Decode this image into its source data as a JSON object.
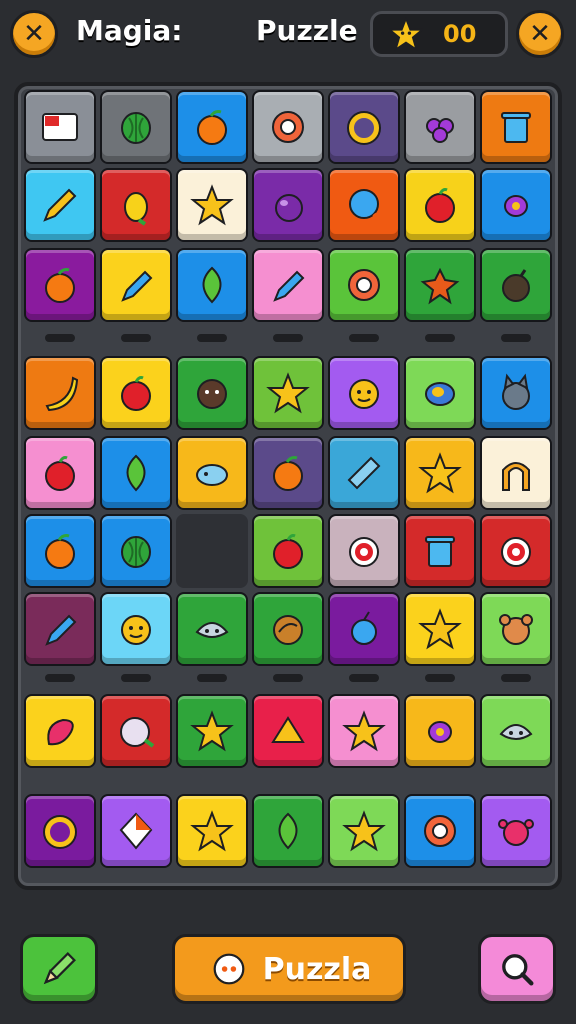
{
  "header": {
    "title_left": "Magia:",
    "title_right": "Puzzle",
    "score": "00",
    "close_glyph": "✕"
  },
  "board": {
    "rows": [
      [
        "#8a8f97",
        "#6f7378",
        "#1d8fe8",
        "#a9aeb3",
        "#5b4a8a",
        "#9a9da1",
        "#ee7a12"
      ],
      [
        "#3fc7f2",
        "#d42a2a",
        "#fbf1d9",
        "#7a2ba8",
        "#f05a12",
        "#f7d21a",
        "#1d8fe8"
      ],
      [
        "#8a1b9e",
        "#fbd21c",
        "#1d8fe8",
        "#f58fd0",
        "#5ac43a",
        "#2fa53a",
        "#2fa53a"
      ],
      [
        "#ee7a12",
        "#fbd21c",
        "#2fa53a",
        "#6fc23a",
        "#a35bf0",
        "#7ed957",
        "#1d8fe8"
      ],
      [
        "#f58fd0",
        "#1d8fe8",
        "#f7b81a",
        "#5b4a8a",
        "#3aa7d8",
        "#f7b81a",
        "#fbf1d9"
      ],
      [
        "#1d8fe8",
        "#1d8fe8",
        null,
        "#6fc23a",
        "#c9b2bd",
        "#d42a2a",
        "#d42a2a"
      ],
      [
        "#7a2b5a",
        "#6cd6f7",
        "#2fa53a",
        "#2fa53a",
        "#7a1b9e",
        "#fbd21c",
        "#7ed957"
      ],
      [
        "#fbd21c",
        "#d42a2a",
        "#2fa53a",
        "#e8204a",
        "#f58fd0",
        "#f7b81a",
        "#7ed957"
      ],
      [
        "#7a1b9e",
        "#a35bf0",
        "#fbd21c",
        "#2fa53a",
        "#7ed957",
        "#1d8fe8",
        "#a35bf0"
      ]
    ],
    "icons": [
      [
        "card",
        "melon",
        "orange",
        "donut",
        "ring",
        "grapes",
        "trash"
      ],
      [
        "pencil",
        "lemon",
        "star",
        "plum",
        "balloon",
        "apple",
        "candy"
      ],
      [
        "orange",
        "crayon",
        "leaf",
        "crayon",
        "donut",
        "bug",
        "bomb"
      ],
      [
        "banana",
        "apple",
        "face",
        "star",
        "smile",
        "shell",
        "cat"
      ],
      [
        "apple",
        "leaf",
        "fish",
        "orange",
        "cannon",
        "star",
        "arch"
      ],
      [
        "orange",
        "melon",
        null,
        "apple",
        "target",
        "trash",
        "target"
      ],
      [
        "crayon",
        "smile",
        "robot",
        "cookie",
        "berry",
        "star",
        "bear"
      ],
      [
        "pepper",
        "turnip",
        "star",
        "cheese",
        "star",
        "candy",
        "robot"
      ],
      [
        "ring",
        "kite",
        "star",
        "leaf",
        "star",
        "donut",
        "crab"
      ]
    ]
  },
  "footer": {
    "puzzle_label": "Puzzla"
  },
  "colors": {
    "accent": "#f5a623",
    "score_text": "#f5b417",
    "background": "#2b2d31"
  }
}
